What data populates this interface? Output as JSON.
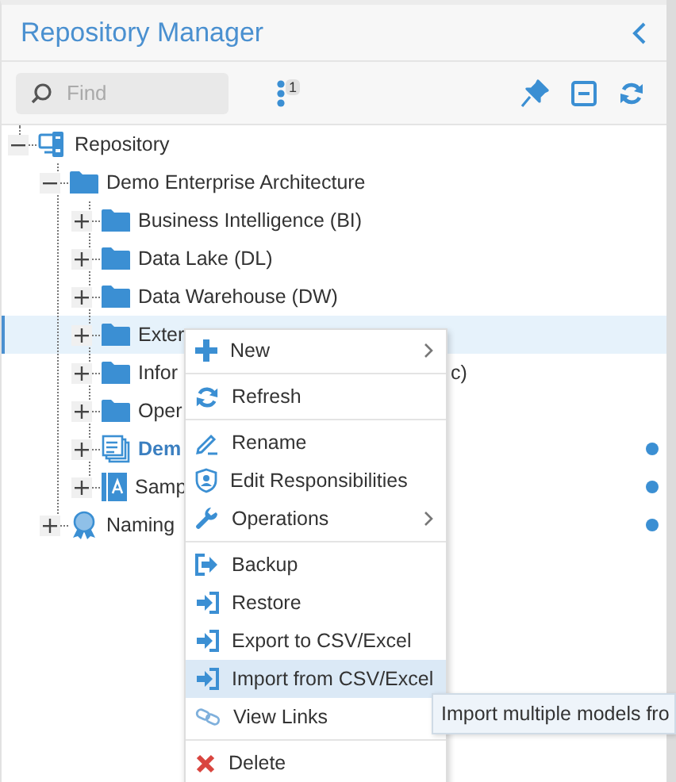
{
  "panel": {
    "title": "Repository Manager"
  },
  "toolbar": {
    "search": {
      "placeholder": "Find"
    },
    "filter_count": "1"
  },
  "tree": [
    {
      "kind": "repository",
      "label": "Repository",
      "expanded": true,
      "selected": false,
      "bold": false,
      "marked": false,
      "children": [
        {
          "kind": "folder",
          "label": "Demo Enterprise Architecture",
          "expanded": true,
          "selected": false,
          "bold": false,
          "marked": false,
          "children": [
            {
              "kind": "folder",
              "label": "Business Intelligence (BI)",
              "expanded": false,
              "selected": false,
              "bold": false,
              "marked": false
            },
            {
              "kind": "folder",
              "label": "Data Lake (DL)",
              "expanded": false,
              "selected": false,
              "bold": false,
              "marked": false
            },
            {
              "kind": "folder",
              "label": "Data Warehouse (DW)",
              "expanded": false,
              "selected": false,
              "bold": false,
              "marked": false
            },
            {
              "kind": "folder",
              "label": "Exter",
              "expanded": false,
              "selected": true,
              "bold": false,
              "marked": false
            },
            {
              "kind": "folder",
              "label": "Infor",
              "tail": "c)",
              "expanded": false,
              "selected": false,
              "bold": false,
              "marked": false
            },
            {
              "kind": "folder",
              "label": "Oper",
              "expanded": false,
              "selected": false,
              "bold": false,
              "marked": false
            },
            {
              "kind": "documents",
              "label": "Dem",
              "expanded": false,
              "selected": false,
              "bold": true,
              "marked": true
            },
            {
              "kind": "model",
              "label": "Samp",
              "expanded": false,
              "selected": false,
              "bold": false,
              "marked": true
            }
          ]
        },
        {
          "kind": "badge",
          "label": "Naming",
          "expanded": false,
          "selected": false,
          "bold": false,
          "marked": true
        }
      ]
    }
  ],
  "context_menu": {
    "groups": [
      [
        {
          "kind": "plus",
          "label": "New",
          "submenu": true,
          "selected": false
        }
      ],
      [
        {
          "kind": "refresh",
          "label": "Refresh",
          "submenu": false,
          "selected": false
        }
      ],
      [
        {
          "kind": "pencil",
          "label": "Rename",
          "submenu": false,
          "selected": false
        },
        {
          "kind": "shield",
          "label": "Edit Responsibilities",
          "submenu": false,
          "selected": false
        },
        {
          "kind": "wrench",
          "label": "Operations",
          "submenu": true,
          "selected": false
        }
      ],
      [
        {
          "kind": "export",
          "label": "Backup",
          "submenu": false,
          "selected": false
        },
        {
          "kind": "import",
          "label": "Restore",
          "submenu": false,
          "selected": false
        },
        {
          "kind": "import",
          "label": "Export to CSV/Excel",
          "submenu": false,
          "selected": false
        },
        {
          "kind": "import",
          "label": "Import from CSV/Excel",
          "submenu": false,
          "selected": true
        },
        {
          "kind": "links",
          "label": "View Links",
          "submenu": false,
          "selected": false
        }
      ],
      [
        {
          "kind": "delete",
          "label": "Delete",
          "submenu": false,
          "selected": false
        }
      ]
    ]
  },
  "tooltip": "Import multiple models fro"
}
